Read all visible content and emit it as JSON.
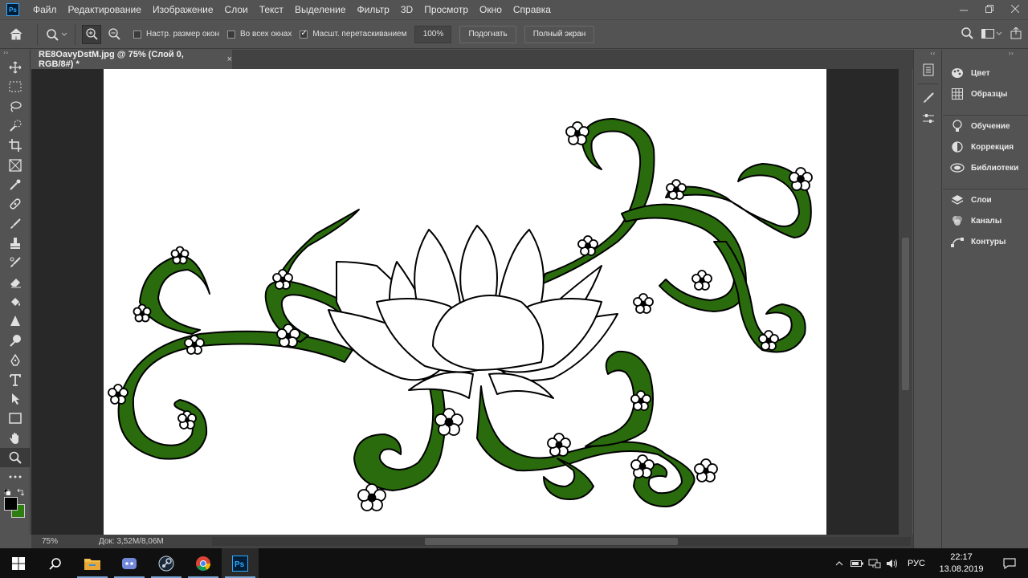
{
  "app": {
    "logo_text": "Ps"
  },
  "menu": [
    "Файл",
    "Редактирование",
    "Изображение",
    "Слои",
    "Текст",
    "Выделение",
    "Фильтр",
    "3D",
    "Просмотр",
    "Окно",
    "Справка"
  ],
  "options": {
    "resize_windows_label": "Настр. размер окон",
    "all_windows_label": "Во всех окнах",
    "scrubby_zoom_label": "Масшт. перетаскиванием",
    "zoom_value": "100%",
    "fit_screen_label": "Подогнать",
    "fill_screen_label": "Полный экран"
  },
  "document": {
    "tab_title": "RE8OavyDstM.jpg @ 75% (Слой 0, RGB/8#) *",
    "tab_close": "×"
  },
  "status": {
    "zoom": "75%",
    "doc_size": "Док: 3,52M/8,06M"
  },
  "panels": [
    {
      "label": "Цвет",
      "icon": "palette-icon"
    },
    {
      "label": "Образцы",
      "icon": "swatches-grid-icon"
    },
    {
      "label": "Обучение",
      "icon": "lightbulb-icon"
    },
    {
      "label": "Коррекция",
      "icon": "adjustments-icon"
    },
    {
      "label": "Библиотеки",
      "icon": "libraries-icon"
    },
    {
      "label": "Слои",
      "icon": "layers-icon"
    },
    {
      "label": "Каналы",
      "icon": "channels-icon"
    },
    {
      "label": "Контуры",
      "icon": "paths-icon"
    }
  ],
  "colors": {
    "foreground": "#000000",
    "background": "#2e7d12",
    "vine": "#2a6b0e"
  },
  "taskbar": {
    "language": "РУС",
    "time": "22:17",
    "date": "13.08.2019",
    "apps": [
      "file-explorer-icon",
      "discord-icon",
      "steam-icon",
      "chrome-icon",
      "photoshop-icon"
    ]
  }
}
